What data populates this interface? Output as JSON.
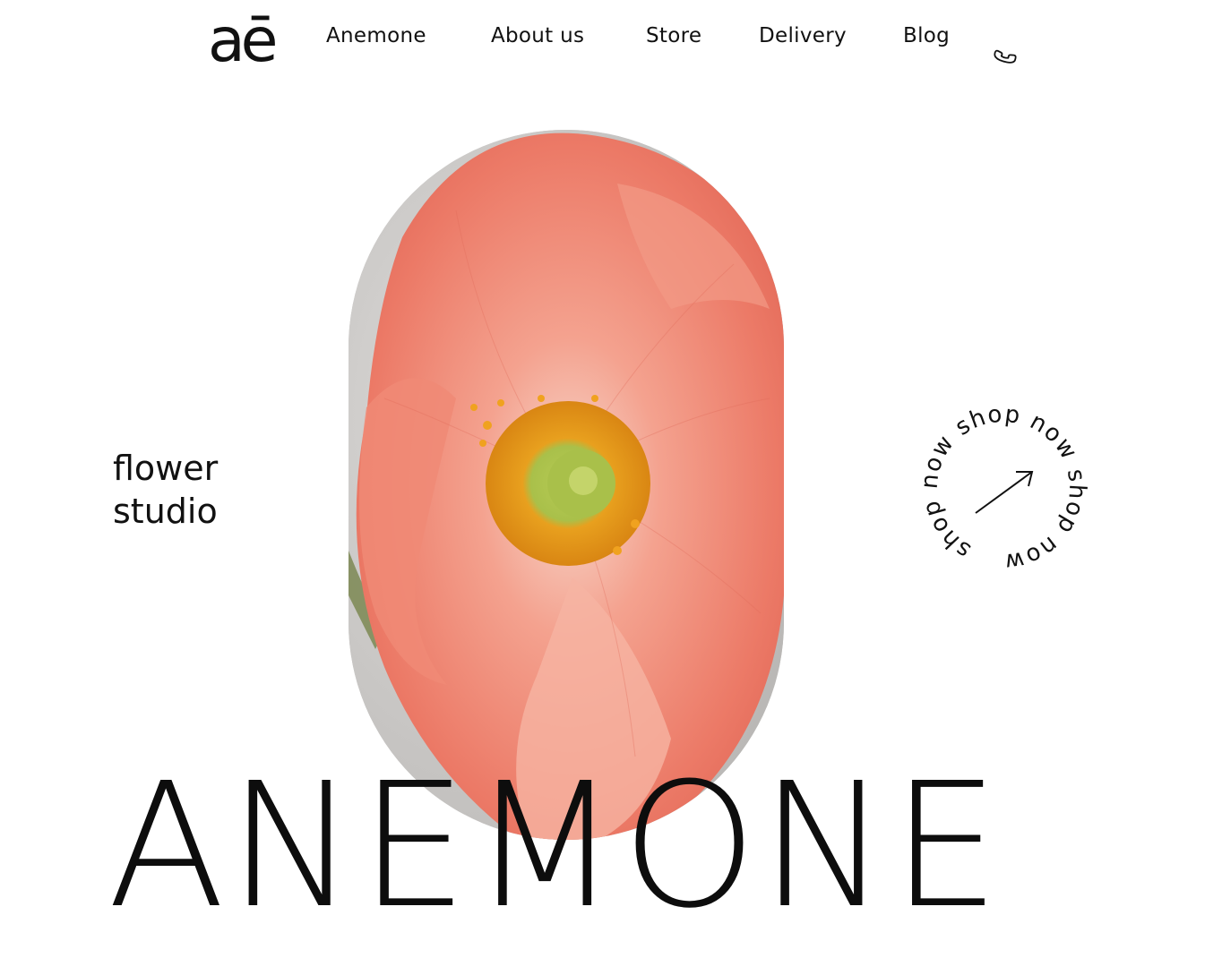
{
  "brand": {
    "logo_text": "aē"
  },
  "nav": {
    "items": [
      {
        "label": "Anemone"
      },
      {
        "label": "About us"
      },
      {
        "label": "Store"
      },
      {
        "label": "Delivery"
      },
      {
        "label": "Blog"
      }
    ],
    "phone_icon": "phone-icon"
  },
  "hero": {
    "tagline": "flower\nstudio",
    "title": "ANEMONE",
    "image_icon": "anemone-flower-photo"
  },
  "shop_badge": {
    "circular_text": "shop now shop now shop now",
    "arrow_icon": "arrow-up-right-icon"
  },
  "colors": {
    "text": "#111111",
    "background": "#ffffff",
    "petal": "#ee7c6b",
    "stamen": "#e59a1c",
    "center": "#a8c14a"
  }
}
